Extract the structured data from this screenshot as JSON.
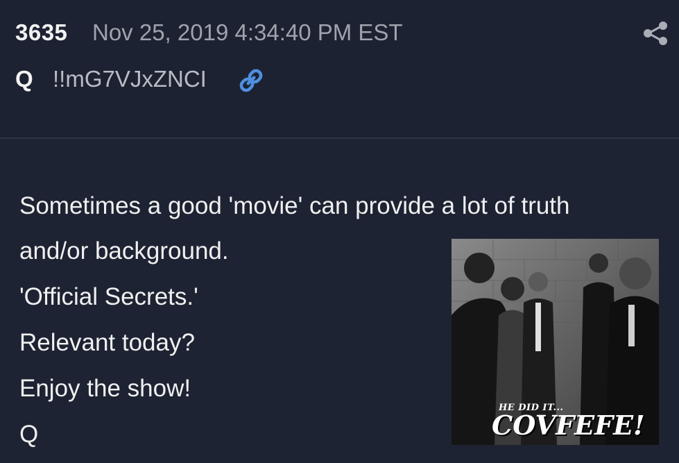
{
  "post": {
    "number": "3635",
    "date": "Nov 25, 2019 4:34:40 PM EST",
    "author": "Q",
    "tripcode": "!!mG7VJxZNCI",
    "icons": {
      "share": "share-icon",
      "link": "link-icon"
    },
    "accent_color": "#4f8fe0"
  },
  "message": {
    "lines": [
      "Sometimes a good 'movie' can provide a lot of truth",
      "and/or background.",
      "'Official Secrets.'",
      "Relevant today?",
      "Enjoy the show!",
      "Q"
    ]
  },
  "attachment": {
    "caption_small": "HE DID IT...",
    "caption_big": "COVFEFE!"
  }
}
